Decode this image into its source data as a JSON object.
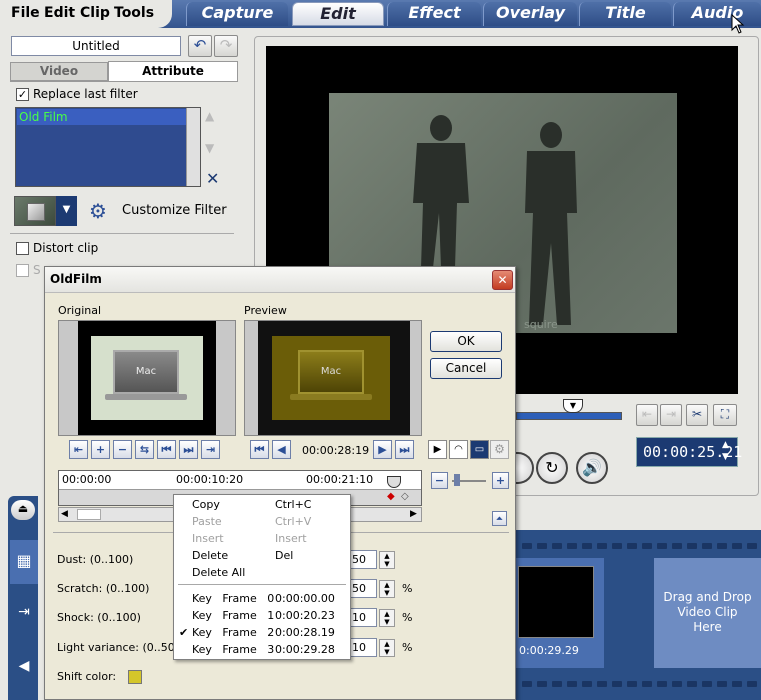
{
  "menu": [
    "File",
    "Edit",
    "Clip",
    "Tools"
  ],
  "tabs": [
    "Capture",
    "Edit",
    "Effect",
    "Overlay",
    "Title",
    "Audio"
  ],
  "active_tab": "Edit",
  "left": {
    "project_name": "Untitled",
    "subtabs": [
      "Video",
      "Attribute"
    ],
    "replace_last_filter": "Replace last filter",
    "filters": [
      "Old Film"
    ],
    "customize_filter": "Customize Filter",
    "distort_clip": "Distort clip",
    "partial_label": "S"
  },
  "preview": {
    "timecode": "00:00:25.21",
    "watermark": "squire"
  },
  "strip": {
    "clip_time": "0:00:29.29",
    "drop_text": [
      "Drag and Drop",
      "Video Clip",
      "Here"
    ]
  },
  "dialog": {
    "title": "OldFilm",
    "original_label": "Original",
    "preview_label": "Preview",
    "thumb_logo": "Mac",
    "current_time": "00:00:28:19",
    "ok": "OK",
    "cancel": "Cancel",
    "ruler": [
      "00:00:00",
      "00:00:10:20",
      "00:00:21:10"
    ],
    "params": [
      {
        "label": "Dust: (0..100)",
        "value": "50",
        "unit": ""
      },
      {
        "label": "Scratch: (0..100)",
        "value": "50",
        "unit": "%"
      },
      {
        "label": "Shock: (0..100)",
        "value": "10",
        "unit": "%"
      },
      {
        "label": "Light variance: (0..50)",
        "value": "10",
        "unit": "%"
      }
    ],
    "shift_color_label": "Shift color:",
    "shift_color": "#d4c62a"
  },
  "context_menu": {
    "items": [
      {
        "label": "Copy",
        "shortcut": "Ctrl+C",
        "enabled": true
      },
      {
        "label": "Paste",
        "shortcut": "Ctrl+V",
        "enabled": false
      },
      {
        "label": "Insert",
        "shortcut": "Insert",
        "enabled": false
      },
      {
        "label": "Delete",
        "shortcut": "Del",
        "enabled": true
      },
      {
        "label": "Delete All",
        "shortcut": "",
        "enabled": true
      }
    ],
    "keyframes": [
      {
        "label": "Key   Frame   0",
        "time": "0:00:00.00",
        "checked": false
      },
      {
        "label": "Key   Frame   1",
        "time": "0:00:20.23",
        "checked": false
      },
      {
        "label": "Key   Frame   2",
        "time": "0:00:28.19",
        "checked": true
      },
      {
        "label": "Key   Frame   3",
        "time": "0:00:29.28",
        "checked": false
      }
    ]
  }
}
